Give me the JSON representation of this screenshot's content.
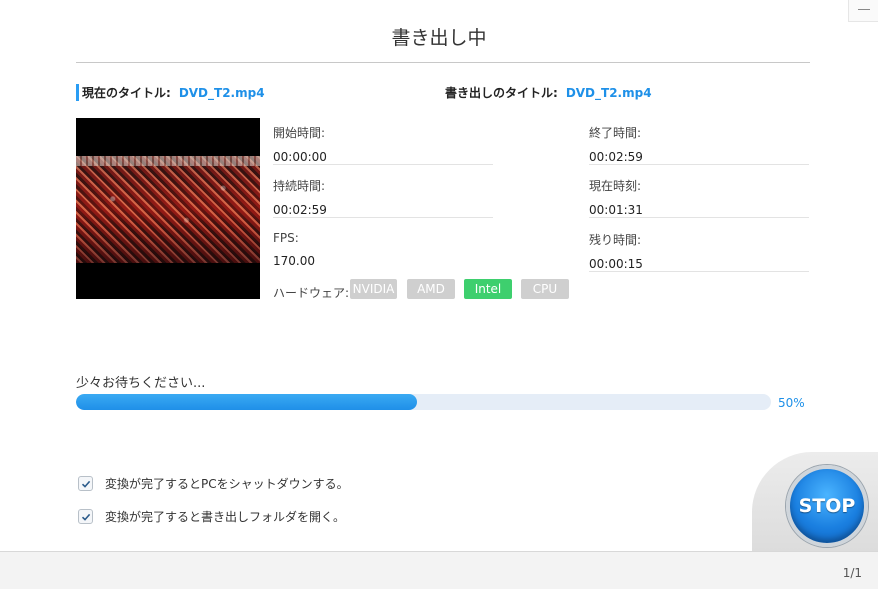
{
  "window": {
    "title": "書き出し中",
    "page_indicator": "1/1"
  },
  "titles": {
    "current_label": "現在のタイトル:",
    "current_value": "DVD_T2.mp4",
    "export_label": "書き出しのタイトル:",
    "export_value": "DVD_T2.mp4"
  },
  "info": {
    "start_time_label": "開始時間:",
    "start_time": "00:00:00",
    "end_time_label": "終了時間:",
    "end_time": "00:02:59",
    "duration_label": "持続時間:",
    "duration": "00:02:59",
    "current_time_label": "現在時刻:",
    "current_time": "00:01:31",
    "fps_label": "FPS:",
    "fps": "170.00",
    "remaining_label": "残り時間:",
    "remaining": "00:00:15"
  },
  "hardware": {
    "label": "ハードウェア:",
    "options": [
      "NVIDIA",
      "AMD",
      "Intel",
      "CPU"
    ],
    "active": "Intel"
  },
  "progress": {
    "message": "少々お待ちください...",
    "percent_label": "50%",
    "fraction": 0.49
  },
  "options": {
    "shutdown_label": "変換が完了するとPCをシャットダウンする。",
    "shutdown_checked": true,
    "open_folder_label": "変換が完了すると書き出しフォルダを開く。",
    "open_folder_checked": true
  },
  "stop_button": {
    "label": "STOP"
  },
  "colors": {
    "accent": "#1e90e8",
    "active_chip": "#3ecf6e",
    "inactive_chip": "#cfcfcf"
  }
}
